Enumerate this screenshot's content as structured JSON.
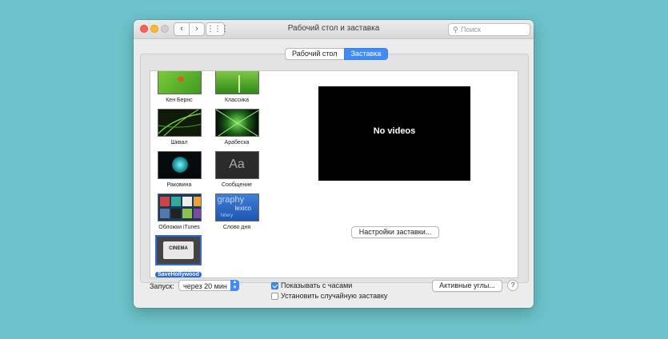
{
  "window": {
    "title": "Рабочий стол и заставка"
  },
  "toolbar": {
    "back_icon": "chevron-left-icon",
    "forward_icon": "chevron-right-icon",
    "grid_icon": "grid-icon",
    "search_placeholder": "Поиск"
  },
  "tabs": [
    {
      "label": "Рабочий стол",
      "active": false
    },
    {
      "label": "Заставка",
      "active": true
    }
  ],
  "savers": [
    {
      "label": "Кен Бернс",
      "thumb": "green-ladybug"
    },
    {
      "label": "Классика",
      "thumb": "green-grass"
    },
    {
      "label": "Шквал",
      "thumb": "green-lines"
    },
    {
      "label": "Арабеска",
      "thumb": "green-rays"
    },
    {
      "label": "Раковина",
      "thumb": "teal-shell"
    },
    {
      "label": "Сообщение",
      "thumb": "aa-text"
    },
    {
      "label": "Обложки iTunes",
      "thumb": "album-grid"
    },
    {
      "label": "Слово дня",
      "thumb": "blue-words"
    },
    {
      "label": "SaveHollywood",
      "thumb": "cinema-ticket",
      "selected": true
    }
  ],
  "thumb_texts": {
    "message_glyph": "Aa",
    "word_line1": "graphy",
    "word_line2": "lexico",
    "word_line3": "hillery",
    "cinema": "CINEMA"
  },
  "preview": {
    "message": "No videos"
  },
  "settings_button": "Настройки заставки...",
  "start": {
    "label": "Запуск:",
    "value": "через 20 мин"
  },
  "checkboxes": [
    {
      "label": "Показывать с часами",
      "checked": true
    },
    {
      "label": "Установить случайную заставку",
      "checked": false
    }
  ],
  "hot_corners_button": "Активные углы...",
  "help_button": "?",
  "colors": {
    "accent": "#3f8cf5",
    "background": "#6cc3cb"
  }
}
